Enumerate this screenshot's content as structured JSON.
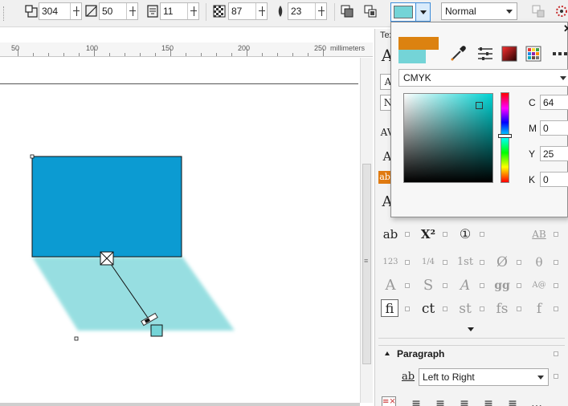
{
  "toolbar": {
    "width_value": "304",
    "height_value": "50",
    "step_value": "11",
    "transparency_value": "87",
    "feather_value": "23",
    "fill_color": "#74d4d7",
    "merge_mode": "Normal"
  },
  "ruler": {
    "labels": [
      "50",
      "100",
      "150",
      "200",
      "250"
    ],
    "unit": "millimeters"
  },
  "canvas": {
    "rect_color": "#0c9bd2",
    "shadow_color": "#74d4d7"
  },
  "docker": {
    "tab_label": "Tex",
    "glyphs": {
      "row1": [
        "ab",
        "X²",
        "①",
        "AB"
      ],
      "row2": [
        "123",
        "1/4",
        "1st",
        "Ø",
        "θ"
      ],
      "row3": [
        "A",
        "S",
        "A",
        "gg",
        "A@"
      ],
      "row4": [
        "fi",
        "ct",
        "st",
        "fs",
        "f"
      ]
    },
    "paragraph_title": "Paragraph",
    "text_direction_label": "ab",
    "text_direction": "Left to Right"
  },
  "color_popup": {
    "old_color": "#dc8210",
    "new_color": "#74d4d7",
    "model": "CMYK",
    "labels": {
      "c": "C",
      "m": "M",
      "y": "Y",
      "k": "K"
    },
    "values": {
      "c": "64",
      "m": "0",
      "y": "25",
      "k": "0"
    },
    "close_label": "✕"
  },
  "icons": [
    "dimension-icon",
    "height-icon",
    "steps-icon",
    "transparency-icon",
    "feather-icon",
    "copy-shadow-icon",
    "clear-shadow-icon",
    "eyedropper-icon",
    "sliders-icon",
    "color-palette-icon",
    "color-grid-icon",
    "more-icon"
  ]
}
